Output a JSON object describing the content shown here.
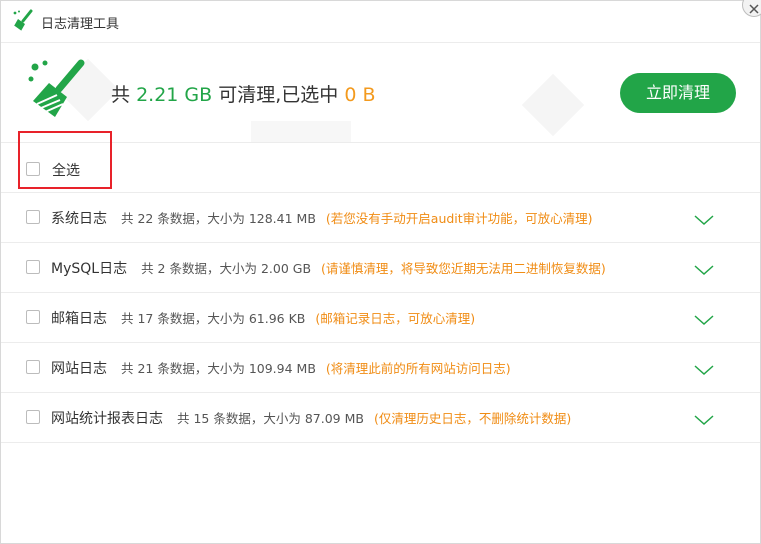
{
  "window": {
    "title": "日志清理工具",
    "close_icon": "close-icon"
  },
  "header": {
    "prefix": "共",
    "total_size": "2.21 GB",
    "middle": "可清理,已选中",
    "selected_size": "0 B",
    "clean_button": "立即清理",
    "icon": "broom-icon",
    "colors": {
      "accent": "#22a548",
      "highlight": "#f39a1e"
    }
  },
  "select_all": {
    "label": "全选",
    "checked": false
  },
  "items": [
    {
      "name": "系统日志",
      "info": "共 22 条数据，大小为 128.41 MB",
      "note": "(若您没有手动开启audit审计功能，可放心清理)",
      "checked": false
    },
    {
      "name": "MySQL日志",
      "info": "共 2 条数据，大小为 2.00 GB",
      "note": "(请谨慎清理，将导致您近期无法用二进制恢复数据)",
      "checked": false
    },
    {
      "name": "邮箱日志",
      "info": "共 17 条数据，大小为 61.96 KB",
      "note": "(邮箱记录日志，可放心清理)",
      "checked": false
    },
    {
      "name": "网站日志",
      "info": "共 21 条数据，大小为 109.94 MB",
      "note": "(将清理此前的所有网站访问日志)",
      "checked": false
    },
    {
      "name": "网站统计报表日志",
      "info": "共 15 条数据，大小为 87.09 MB",
      "note": "(仅清理历史日志，不删除统计数据)",
      "checked": false
    }
  ]
}
